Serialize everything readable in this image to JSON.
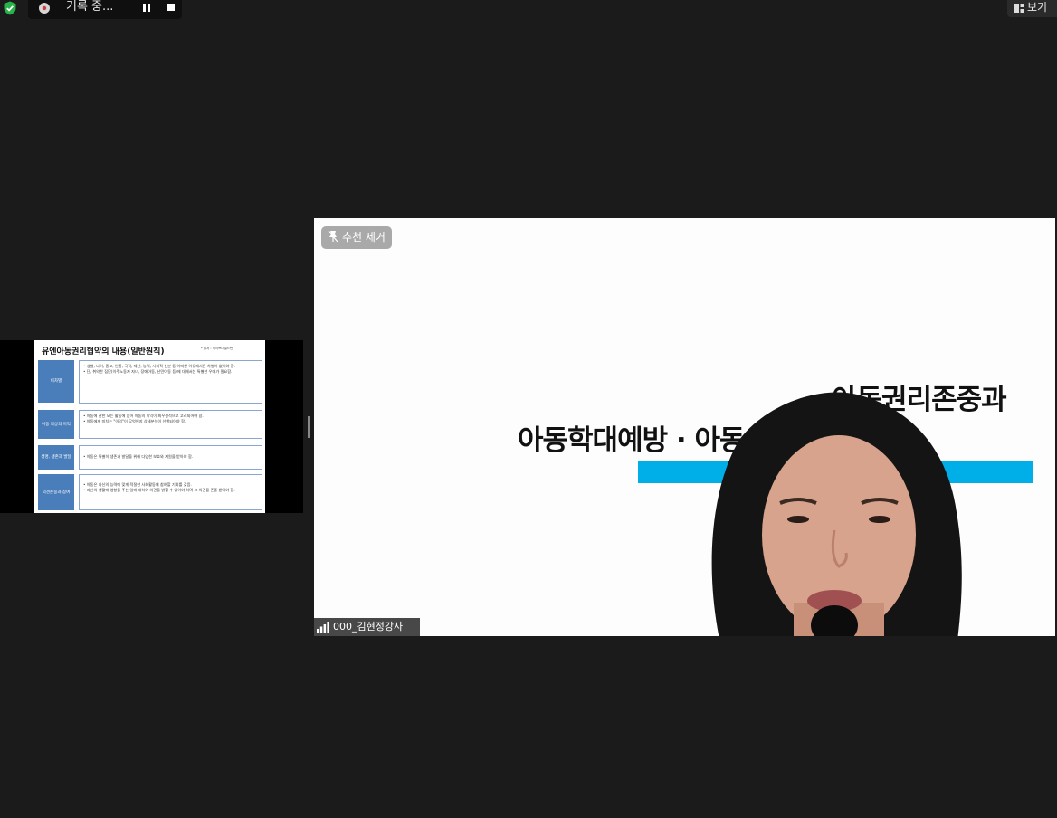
{
  "topbar": {
    "recording_label": "기록 중...",
    "view_label": "보기"
  },
  "shared_slide": {
    "title": "유엔아동권리협약의 내용(일반원칙)",
    "note": "* 출처 : 세이브더칠드런",
    "rows": [
      {
        "label": "비차별",
        "lines": [
          "• 성별, 나이, 종교, 인종, 국적, 재산, 능력, 사회적 신분 등 어떠한 이유에서든 차별이 없어야 함.",
          "• 단, 취약한 집단(이주노동자 자녀, 장애아동, 난민아동 등)에 대해서는 특별한 우대가 필요함."
        ]
      },
      {
        "label": "아동 최상의 이익",
        "lines": [
          "• 아동에 관한 모든 활동에 있어 아동의 이익이 최우선적으로 고려되어야 함.",
          "• 아동에게 미치는 \"이익\"이 무엇인지 상세분석이 선행되어야 함."
        ]
      },
      {
        "label": "생명, 생존과 발달",
        "lines": [
          "• 아동은 특별히 생존과 발달을 위해 다양한 보호와 지원을 받아야 함."
        ]
      },
      {
        "label": "의견존중과 참여",
        "lines": [
          "• 아동은 자신의 능력에 맞게 적절한 사회활동에 참여할 기회를 갖음.",
          "• 자신의 생활에 영향을 주는 일에 대하여 의견을 밝힐 수 있어야 하며 그 의견을 존중 받아야 함."
        ]
      }
    ]
  },
  "main_video": {
    "unpin_label": "추천 제거",
    "bg_title_line1": "아동권리존중과",
    "bg_title_line2": "아동학대예방 · 아동                    실무자 교육",
    "participant_name": "000_김현정강사"
  },
  "colors": {
    "background": "#1b1b1b",
    "slide_label_blue": "#4a7ebb",
    "accent_bar": "#00aee8",
    "shield_green": "#27b24a"
  }
}
